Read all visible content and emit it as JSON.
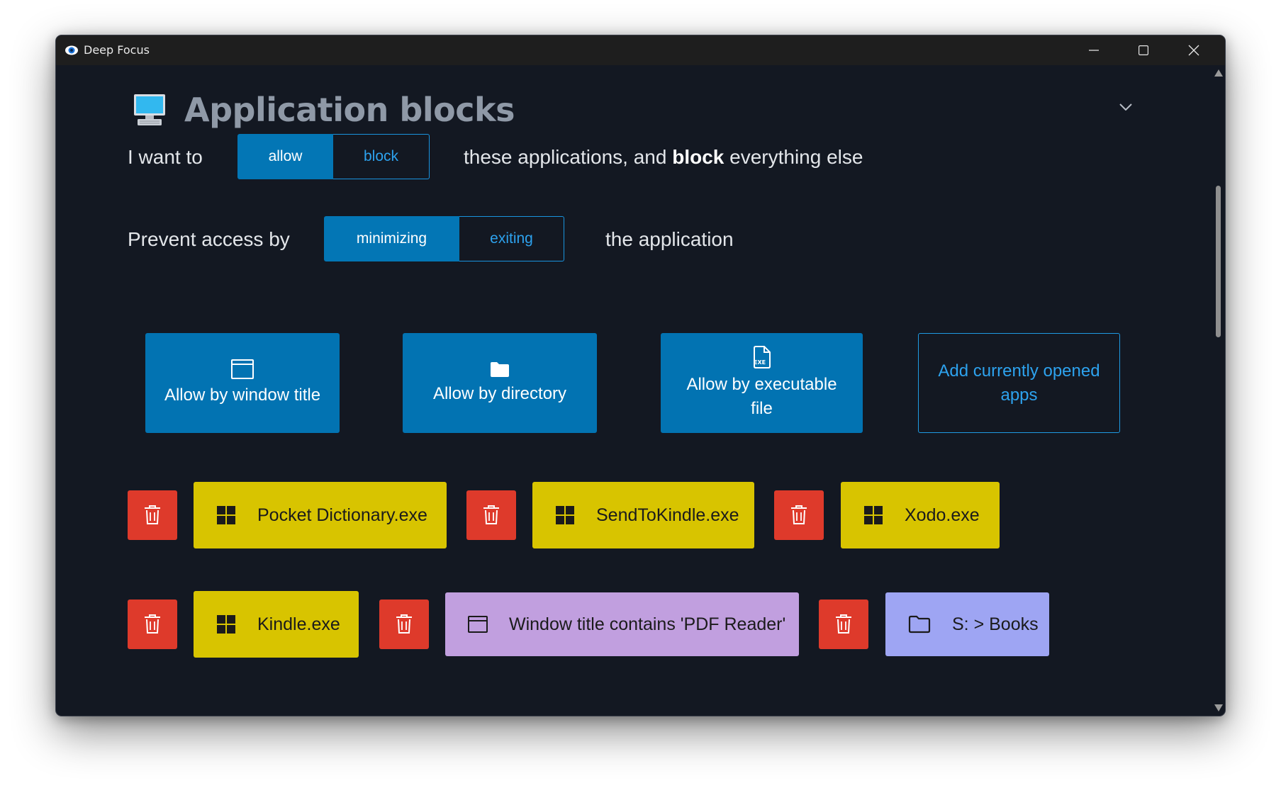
{
  "window": {
    "title": "Deep Focus"
  },
  "section": {
    "title": "Application blocks"
  },
  "mode": {
    "prefix": "I want to",
    "options": [
      "allow",
      "block"
    ],
    "selected": "allow",
    "suffix_1": "these applications, and",
    "suffix_bold": "block",
    "suffix_2": "everything else"
  },
  "prevent": {
    "prefix": "Prevent access by",
    "options": [
      "minimizing",
      "exiting"
    ],
    "selected": "minimizing",
    "suffix": "the application"
  },
  "actions": {
    "window_title": "Allow by window title",
    "directory": "Allow by directory",
    "executable": "Allow by executable file",
    "add_opened": "Add currently opened apps"
  },
  "rules": [
    {
      "type": "executable",
      "label": "Pocket Dictionary.exe",
      "icon": "windows-app-icon"
    },
    {
      "type": "executable",
      "label": "SendToKindle.exe",
      "icon": "windows-app-icon"
    },
    {
      "type": "executable",
      "label": "Xodo.exe",
      "icon": "windows-app-icon"
    },
    {
      "type": "executable",
      "label": "Kindle.exe",
      "icon": "windows-app-icon"
    },
    {
      "type": "window_title",
      "label": "Window title contains 'PDF Reader'",
      "icon": "window-icon"
    },
    {
      "type": "directory",
      "label": "S: > Books",
      "icon": "folder-icon"
    }
  ],
  "colors": {
    "background": "#131822",
    "accent": "#0376b5",
    "executable_chip": "#d8c400",
    "window_title_chip": "#c19fdf",
    "directory_chip": "#9ea5f3",
    "delete": "#de3a2b"
  }
}
